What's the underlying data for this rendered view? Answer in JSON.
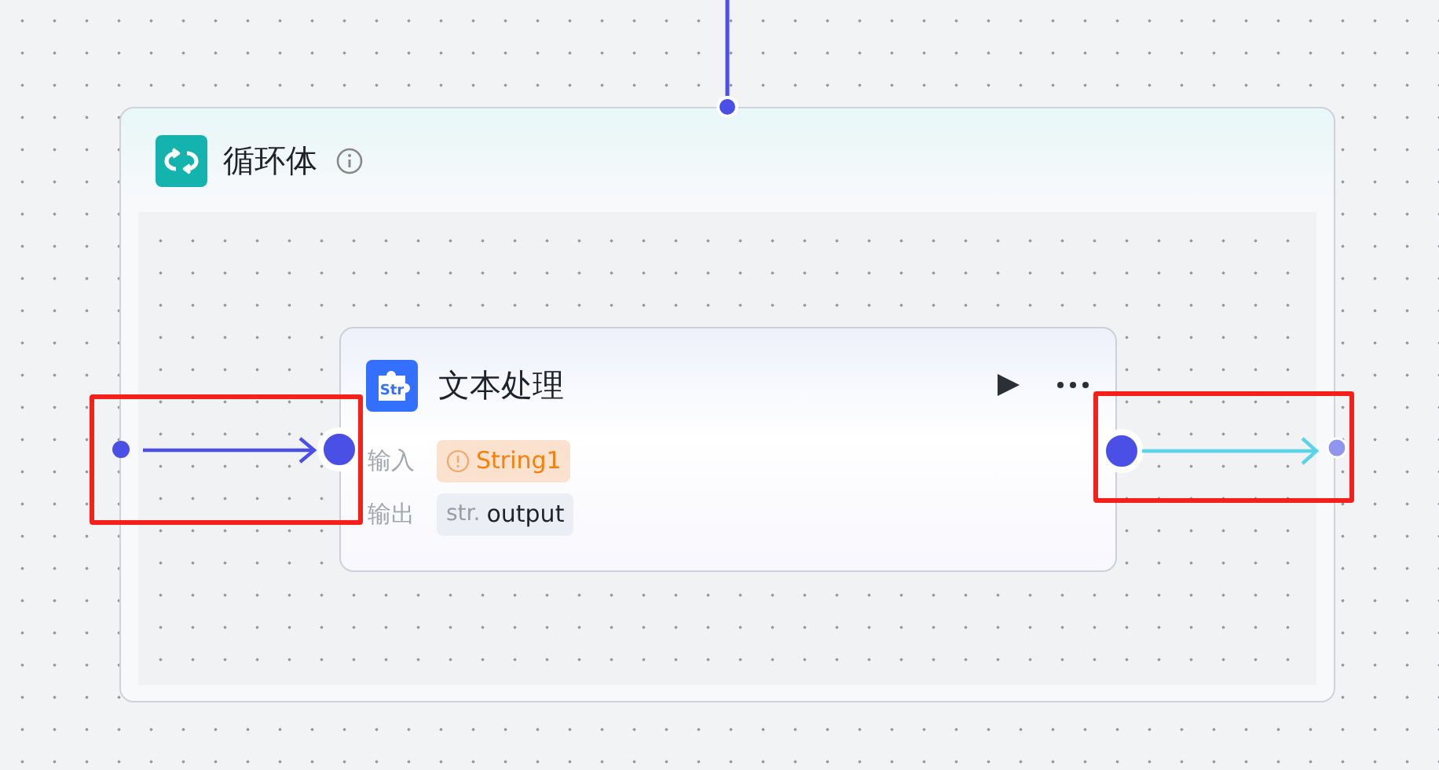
{
  "loop_node": {
    "title": "循环体"
  },
  "text_node": {
    "title": "文本处理",
    "icon_text": "Str",
    "params": [
      {
        "label": "输入",
        "kind": "warning",
        "value": "String1"
      },
      {
        "label": "输出",
        "kind": "typed",
        "prefix": "str.",
        "value": "output"
      }
    ]
  },
  "annotations": [
    {
      "kind": "highlight"
    },
    {
      "kind": "highlight"
    }
  ]
}
